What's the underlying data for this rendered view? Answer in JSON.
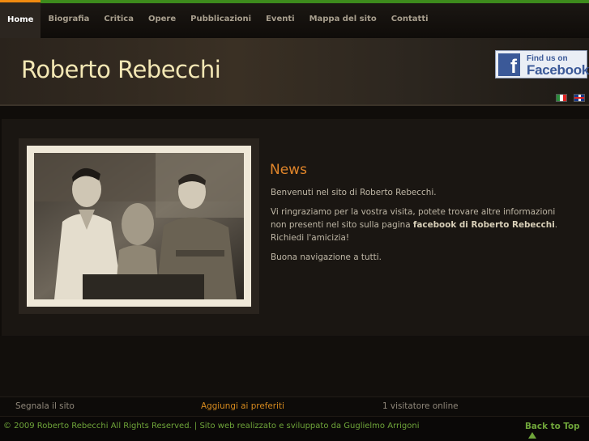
{
  "nav": {
    "items": [
      {
        "label": "Home",
        "active": true
      },
      {
        "label": "Biografia",
        "active": false
      },
      {
        "label": "Critica",
        "active": false
      },
      {
        "label": "Opere",
        "active": false
      },
      {
        "label": "Pubblicazioni",
        "active": false
      },
      {
        "label": "Eventi",
        "active": false
      },
      {
        "label": "Mappa del sito",
        "active": false
      },
      {
        "label": "Contatti",
        "active": false
      }
    ]
  },
  "header": {
    "site_title": "Roberto Rebecchi",
    "facebook": {
      "logo": "f",
      "line1": "Find us on",
      "line2": "Facebook"
    },
    "languages": [
      {
        "name": "flag-italian-icon"
      },
      {
        "name": "flag-english-icon"
      }
    ]
  },
  "main": {
    "news_title": "News",
    "paragraph_1": "Benvenuti nel sito di Roberto Rebecchi.",
    "paragraph_2_before": "Vi ringraziamo per la vostra visita, potete trovare altre informazioni non presenti nel sito sulla pagina ",
    "paragraph_2_link": "facebook di Roberto Rebecchi",
    "paragraph_2_after": ". Richiedi l'amicizia!",
    "paragraph_3": "Buona navigazione a tutti."
  },
  "footer": {
    "link_1": "Segnala il sito",
    "link_2": "Aggiungi ai preferiti",
    "visitors": "1 visitatore online",
    "copyright": "© 2009 Roberto Rebecchi All Rights Reserved. | Sito web realizzato e sviluppato da Guglielmo Arrigoni",
    "back_to_top": "Back to Top"
  },
  "colors": {
    "accent_green": "#3d8b1c",
    "accent_orange": "#f08a10",
    "title_color": "#f3e7b4",
    "news_color": "#e0852a"
  }
}
